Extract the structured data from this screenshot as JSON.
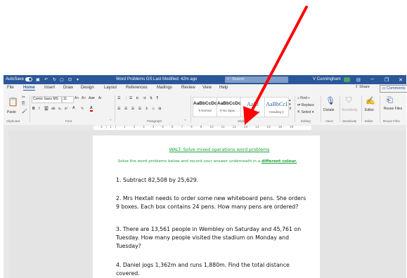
{
  "titlebar": {
    "autosave": "AutoSave",
    "toggle": "On",
    "doc_title": "Word Problems GS",
    "modified": "Last Modified: 42m ago",
    "search": "Search",
    "user": "V Cunningham",
    "user_initials": "VC"
  },
  "menu": {
    "tabs": [
      "File",
      "Home",
      "Insert",
      "Draw",
      "Design",
      "Layout",
      "References",
      "Mailings",
      "Review",
      "View",
      "Help"
    ],
    "share": "Share",
    "comments": "Comments"
  },
  "ribbon": {
    "paste": "Paste",
    "font_name": "Comic Sans MS",
    "font_size": "11",
    "styles": [
      {
        "preview": "AaBbCcDc",
        "name": "¶ Normal"
      },
      {
        "preview": "AaBbCcDc",
        "name": "¶ No Spac..."
      },
      {
        "preview": "AaBl",
        "name": "Heading 1"
      },
      {
        "preview": "AaBbCcI",
        "name": "Heading 2"
      }
    ],
    "find": "Find",
    "replace": "Replace",
    "select": "Select",
    "dictate": "Dictate",
    "sensitivity": "Sensitivity",
    "editor": "Editor",
    "reuse_files": "Reuse Files",
    "groups": [
      "Clipboard",
      "Font",
      "Paragraph",
      "Styles",
      "Editing",
      "Voice",
      "Sensitivity",
      "Editor",
      "Reuse Files"
    ]
  },
  "ruler": {
    "marks": "· 2 · | · 1 · | · · · 1 · · · 2 · · · 3 · · · 4 · · · 5 · · · 6 · · · 7 · · · 8 · · · 9 · · · 10 · · · 11 · · · 12 · · · 13 · · · 14 · · · 15 · · · 16 · · · 18"
  },
  "document": {
    "walt": "WALT: Solve mixed operations word problems",
    "instruction_pre": "Solve the word problems below and record your answer underneath in a",
    "instruction_em": "different colour.",
    "questions": [
      "1.  Subtract 82,508 by 25,629.",
      "2.  Mrs Hextall needs to order some new whiteboard pens. She orders 9 boxes. Each box contains 24 pens. How many pens are ordered?",
      "3.  There are 13,561 people in Wembley on Saturday and 45,761 on Tuesday. How many people visited the stadium on Monday and Tuesday?",
      "4.  Daniel jogs 1,362m and runs 1,880m. Find the total distance covered."
    ]
  },
  "colors": {
    "word_blue": "#2b579a",
    "doc_green": "#1aa33a",
    "arrow_red": "#ff0000"
  }
}
